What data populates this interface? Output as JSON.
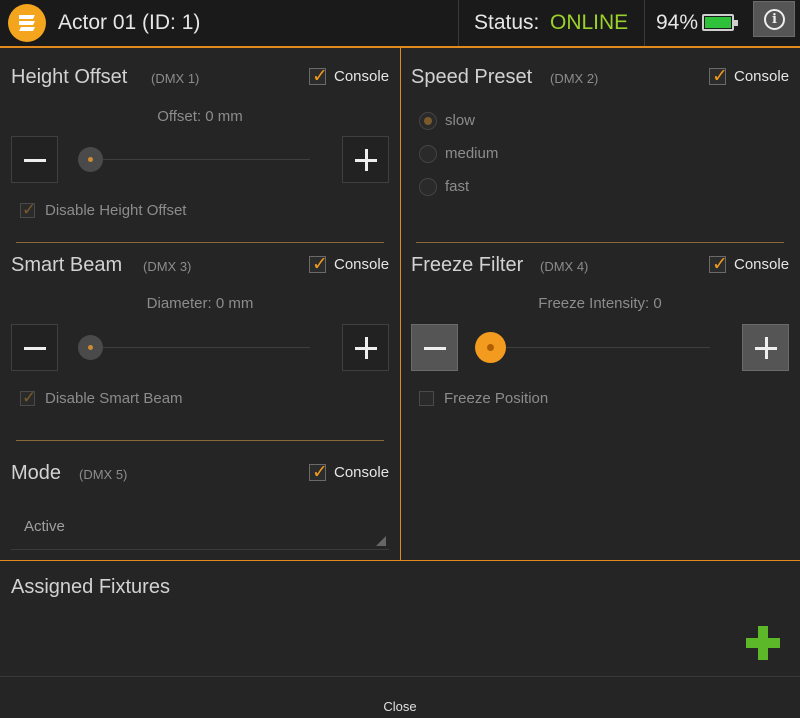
{
  "header": {
    "title": "Actor 01 (ID: 1)",
    "status_label": "Status:",
    "status_value": "ONLINE",
    "battery_percent": "94%",
    "battery_level": 0.94,
    "info_glyph": "i"
  },
  "colors": {
    "accent": "#e08a1e",
    "online": "#9bd12a",
    "battery": "#2fc13a",
    "add": "#5cb828"
  },
  "height_offset": {
    "title": "Height Offset",
    "dmx": "(DMX 1)",
    "console_label": "Console",
    "console_checked": true,
    "value_text": "Offset: 0 mm",
    "disable_label": "Disable Height Offset",
    "disable_checked": true
  },
  "speed_preset": {
    "title": "Speed Preset",
    "dmx": "(DMX 2)",
    "console_label": "Console",
    "console_checked": true,
    "options": [
      "slow",
      "medium",
      "fast"
    ],
    "selected": "slow"
  },
  "smart_beam": {
    "title": "Smart Beam",
    "dmx": "(DMX 3)",
    "console_label": "Console",
    "console_checked": true,
    "value_text": "Diameter: 0 mm",
    "disable_label": "Disable Smart Beam",
    "disable_checked": true
  },
  "freeze_filter": {
    "title": "Freeze Filter",
    "dmx": "(DMX 4)",
    "console_label": "Console",
    "console_checked": true,
    "value_text": "Freeze Intensity: 0",
    "position_label": "Freeze Position",
    "position_checked": false
  },
  "mode": {
    "title": "Mode",
    "dmx": "(DMX 5)",
    "console_label": "Console",
    "console_checked": true,
    "value": "Active"
  },
  "assigned": {
    "title": "Assigned Fixtures"
  },
  "footer": {
    "close_label": "Close"
  },
  "icons": {
    "logo": "zeta-logo-icon",
    "battery": "battery-icon",
    "info": "info-icon",
    "minus": "minus-icon",
    "plus": "plus-icon",
    "add": "add-fixture-icon",
    "check": "checkmark-icon"
  }
}
